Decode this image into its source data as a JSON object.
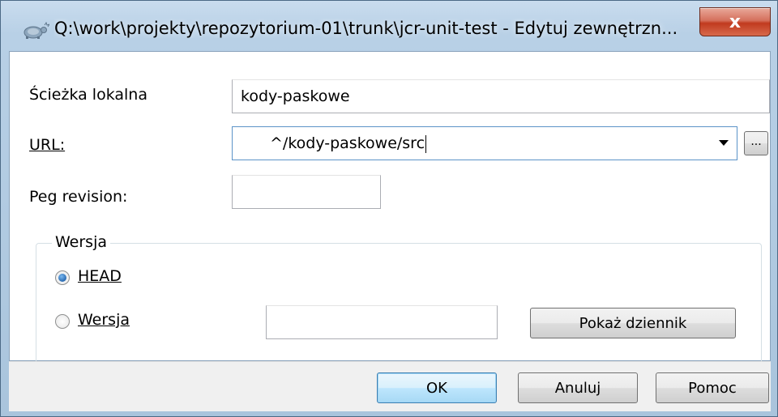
{
  "window": {
    "title": "Q:\\work\\projekty\\repozytorium-01\\trunk\\jcr-unit-test - Edytuj zewnętrzn...",
    "close_label": "x"
  },
  "form": {
    "local_path_label": "Ścieżka lokalna",
    "local_path_value": "kody-paskowe",
    "url_label": "URL:",
    "url_value": "^/kody-paskowe/src",
    "browse_label": "...",
    "peg_label": "Peg revision:",
    "peg_value": ""
  },
  "revision_group": {
    "title": "Wersja",
    "head_label": "HEAD",
    "head_checked": true,
    "rev_label": "Wersja",
    "rev_checked": false,
    "rev_value": "",
    "show_log_label": "Pokaż dziennik"
  },
  "footer": {
    "ok_label": "OK",
    "cancel_label": "Anuluj",
    "help_label": "Pomoc"
  },
  "colors": {
    "close_button": "#c13a1f",
    "default_button_border": "#3c7fb1",
    "radio_fill": "#1e5fa8"
  },
  "icons": {
    "title_icon": "tortoise-svn-icon",
    "combo_arrow": "dropdown-arrow-icon"
  }
}
